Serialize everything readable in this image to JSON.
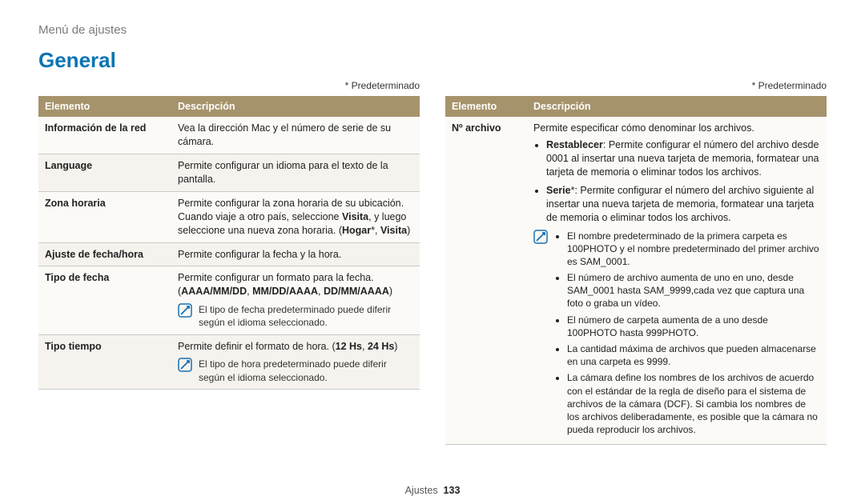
{
  "breadcrumb": "Menú de ajustes",
  "heading": "General",
  "default_note": "* Predeterminado",
  "table_head": {
    "col1": "Elemento",
    "col2": "Descripción"
  },
  "left": {
    "rows": [
      {
        "label": "Información de la red",
        "desc": "Vea la dirección Mac y el número de serie de su cámara."
      },
      {
        "label": "Language",
        "desc": "Permite configurar un idioma para el texto de la pantalla."
      }
    ],
    "zona": {
      "label": "Zona horaria",
      "l1": "Permite configurar la zona horaria de su ubicación.",
      "l2a": "Cuando viaje a otro país, seleccione ",
      "l2b": "Visita",
      "l2c": ", y luego",
      "l3a": "seleccione una nueva zona horaria. (",
      "l3b": "Hogar",
      "l3c": "*, ",
      "l3d": "Visita",
      "l3e": ")"
    },
    "ajuste": {
      "label": "Ajuste de fecha/hora",
      "desc": "Permite configurar la fecha y la hora."
    },
    "tipo_fecha": {
      "label": "Tipo de fecha",
      "l1": "Permite configurar un formato para la fecha.",
      "l2a": "(",
      "l2b": "AAAA/MM/DD",
      "l2c": ", ",
      "l2d": "MM/DD/AAAA",
      "l2e": ", ",
      "l2f": "DD/MM/AAAA",
      "l2g": ")",
      "note": "El tipo de fecha predeterminado puede diferir según el idioma seleccionado."
    },
    "tipo_tiempo": {
      "label": "Tipo tiempo",
      "l1a": "Permite definir el formato de hora. (",
      "l1b": "12 Hs",
      "l1c": ", ",
      "l1d": "24 Hs",
      "l1e": ")",
      "note": "El tipo de hora predeterminado puede diferir según el idioma seleccionado."
    }
  },
  "right": {
    "label": "Nº archivo",
    "intro": "Permite especificar cómo denominar los archivos.",
    "reset": {
      "b": "Restablecer",
      "t": ": Permite configurar el número del archivo desde 0001 al insertar una nueva tarjeta de memoria, formatear una tarjeta de memoria o eliminar todos los archivos."
    },
    "serie": {
      "b": "Serie",
      "t": "*: Permite configurar el número del archivo siguiente al insertar una nueva tarjeta de memoria, formatear una tarjeta de memoria o eliminar todos los archivos."
    },
    "notes": [
      "El nombre predeterminado de la primera carpeta es 100PHOTO y el nombre predeterminado del primer archivo es SAM_0001.",
      "El número de archivo aumenta de uno en uno, desde SAM_0001 hasta SAM_9999,cada vez que captura una foto o graba un vídeo.",
      "El número de carpeta aumenta de a uno desde 100PHOTO hasta 999PHOTO.",
      "La cantidad máxima de archivos que pueden almacenarse en una carpeta es 9999.",
      "La cámara define los nombres de los archivos de acuerdo con el estándar de la regla de diseño para el sistema de archivos de la cámara (DCF). Si cambia los nombres de los archivos deliberadamente, es posible que la cámara no pueda reproducir los archivos."
    ]
  },
  "footer": {
    "section": "Ajustes",
    "page": "133"
  }
}
